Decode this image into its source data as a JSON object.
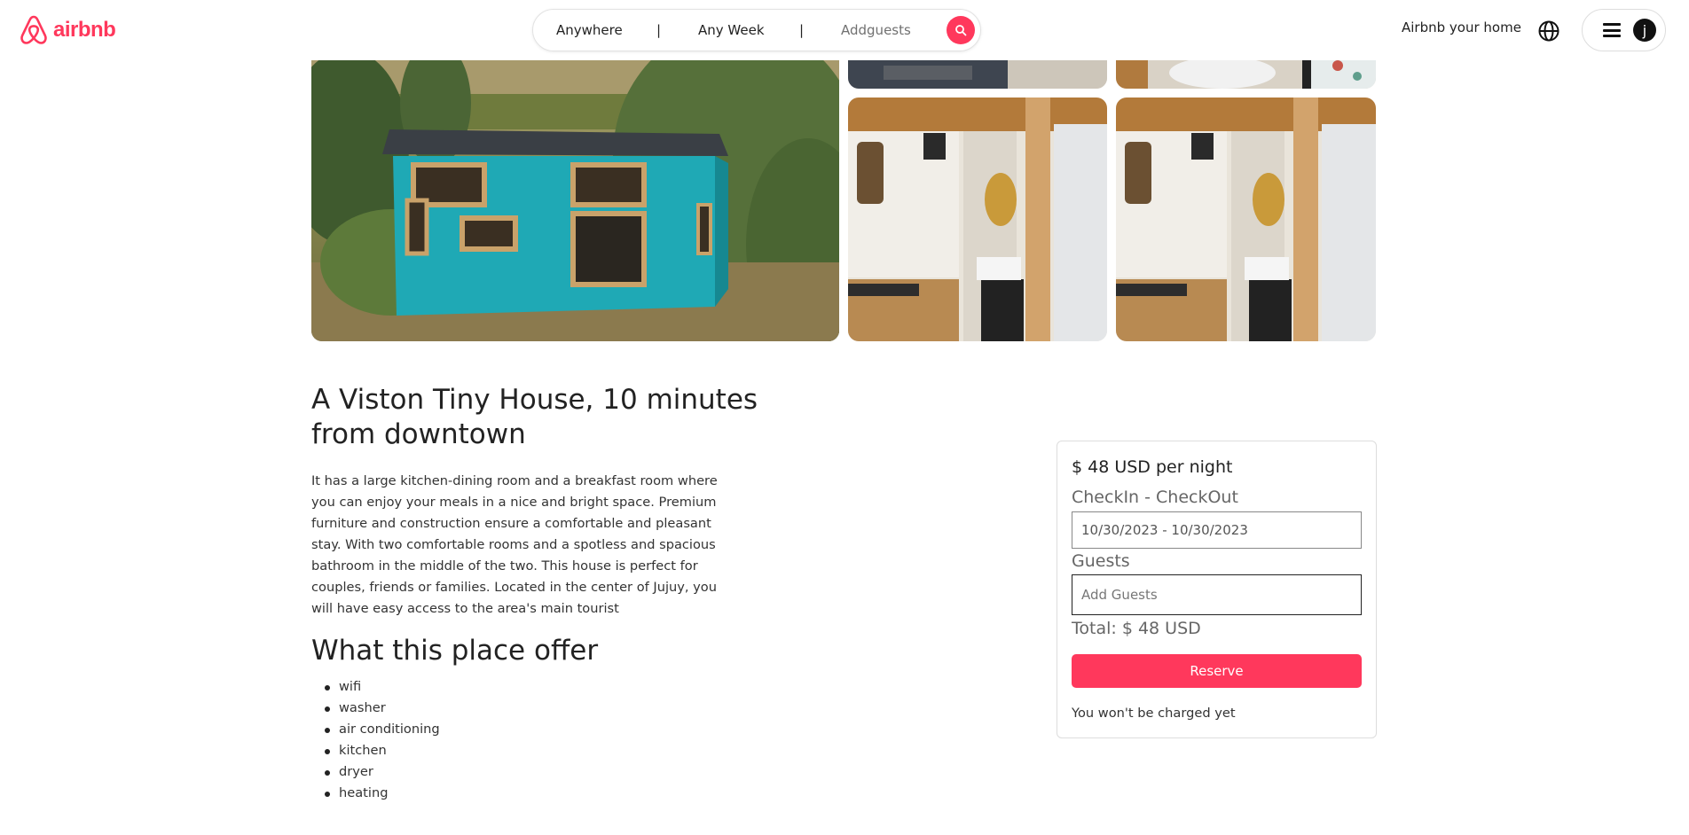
{
  "header": {
    "logo_text": "airbnb",
    "brand_color": "#ff385c",
    "search": {
      "location": "Anywhere",
      "divider": "|",
      "week": "Any Week",
      "guests": "Addguests",
      "button_icon": "search-icon"
    },
    "host_link": "Airbnb your home",
    "globe_icon": "globe-icon",
    "menu_icon": "hamburger-icon",
    "avatar_initial": "j"
  },
  "gallery": {
    "photos": [
      "tiny-house-exterior",
      "interior-top-left",
      "bathroom-top-right",
      "kitchen-interior",
      "kitchen-interior"
    ]
  },
  "listing": {
    "title": "A Viston Tiny House, 10 minutes from downtown",
    "description": "It has a large kitchen-dining room and a breakfast room where you can enjoy your meals in a nice and bright space. Premium furniture and construction ensure a comfortable and pleasant stay. With two comfortable rooms and a spotless and spacious bathroom in the middle of the two. This house is perfect for couples, friends or families. Located in the center of Jujuy, you will have easy access to the area's main tourist",
    "offers_title": "What this place offer",
    "amenities": [
      "wifi",
      "washer",
      "air conditioning",
      "kitchen",
      "dryer",
      "heating"
    ]
  },
  "booking": {
    "price": "$ 48 USD per night",
    "dates_label": "CheckIn - CheckOut",
    "dates_value": "10/30/2023 - 10/30/2023",
    "guests_label": "Guests",
    "guests_placeholder": "Add Guests",
    "total": "Total: $ 48 USD",
    "reserve_label": "Reserve",
    "note": "You won't be charged yet"
  }
}
